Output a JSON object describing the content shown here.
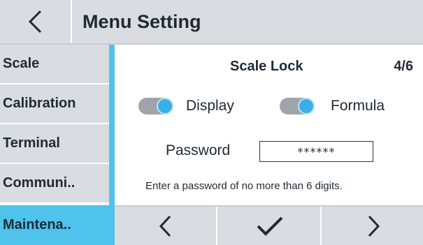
{
  "header": {
    "title": "Menu Setting",
    "back_icon": "chevron-left-icon"
  },
  "sidebar": {
    "items": [
      {
        "label": "Scale",
        "active": false
      },
      {
        "label": "Calibration",
        "active": false
      },
      {
        "label": "Terminal",
        "active": false
      },
      {
        "label": "Communi..",
        "active": false
      },
      {
        "label": "Maintena..",
        "active": true
      }
    ],
    "accent_color": "#4fc3ec"
  },
  "main": {
    "title": "Scale Lock",
    "page_indicator": "4/6",
    "toggles": [
      {
        "label": "Display",
        "on": true
      },
      {
        "label": "Formula",
        "on": true
      }
    ],
    "password": {
      "label": "Password",
      "value": "******"
    },
    "hint": "Enter a password of no more than 6 digits."
  },
  "bottom_nav": {
    "prev_icon": "chevron-left-icon",
    "confirm_icon": "checkmark-icon",
    "next_icon": "chevron-right-icon"
  },
  "colors": {
    "header_bg": "#d9dde1",
    "accent": "#4fc3ec",
    "toggle_knob": "#3aaee8",
    "toggle_track": "#9ea4a9"
  }
}
